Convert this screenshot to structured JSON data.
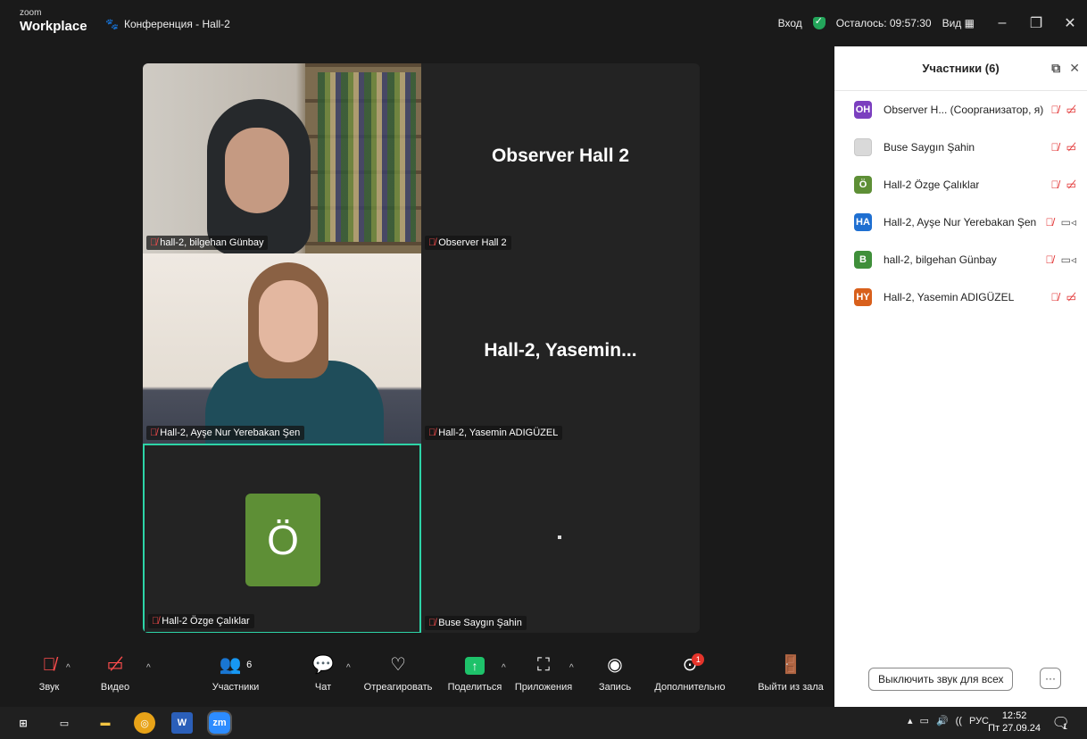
{
  "titlebar": {
    "logo_top": "zoom",
    "logo_bottom": "Workplace",
    "meeting_title": "Конференция - Hall-2",
    "login": "Вход",
    "time_left": "Осталось: 09:57:30",
    "view": "Вид"
  },
  "tiles": [
    {
      "name": "hall-2, bilgehan Günbay",
      "big": ""
    },
    {
      "name": "Observer  Hall 2",
      "big": "Observer  Hall 2"
    },
    {
      "name": "Hall-2, Ayşe Nur Yerebakan Şen",
      "big": ""
    },
    {
      "name": "Hall-2, Yasemin ADIGÜZEL",
      "big": "Hall-2,  Yasemin..."
    },
    {
      "name": "Hall-2 Özge Çalıklar",
      "avatar": "Ö"
    },
    {
      "name": "Buse Saygın Şahin",
      "big": ""
    }
  ],
  "panel": {
    "title": "Участники (6)",
    "participants": [
      {
        "initials": "OH",
        "color": "#7b3fbf",
        "name": "Observer  H... (Соорганизатор, я)",
        "video": "off"
      },
      {
        "initials": "",
        "color": "#d9d9d9",
        "name": "Buse Saygın Şahin",
        "video": "off"
      },
      {
        "initials": "Ö",
        "color": "#5e8f36",
        "name": "Hall-2 Özge Çalıklar",
        "video": "off"
      },
      {
        "initials": "HA",
        "color": "#1f6fd1",
        "name": "Hall-2, Ayşe Nur Yerebakan Şen",
        "video": "on"
      },
      {
        "initials": "B",
        "color": "#3f8f3a",
        "name": "hall-2, bilgehan Günbay",
        "video": "on"
      },
      {
        "initials": "HY",
        "color": "#d8601c",
        "name": "Hall-2, Yasemin ADIGÜZEL",
        "video": "off"
      }
    ],
    "mute_all": "Выключить звук для всех",
    "more": "···"
  },
  "toolbar": {
    "audio": "Звук",
    "video": "Видео",
    "participants": "Участники",
    "participants_count": "6",
    "chat": "Чат",
    "react": "Отреагировать",
    "share": "Поделиться",
    "apps": "Приложения",
    "record": "Запись",
    "more": "Дополнительно",
    "more_badge": "1",
    "leave": "Выйти из зала"
  },
  "taskbar": {
    "lang": "РУС",
    "time": "12:52",
    "date": "Пт 27.09.24",
    "notif_count": "1"
  }
}
